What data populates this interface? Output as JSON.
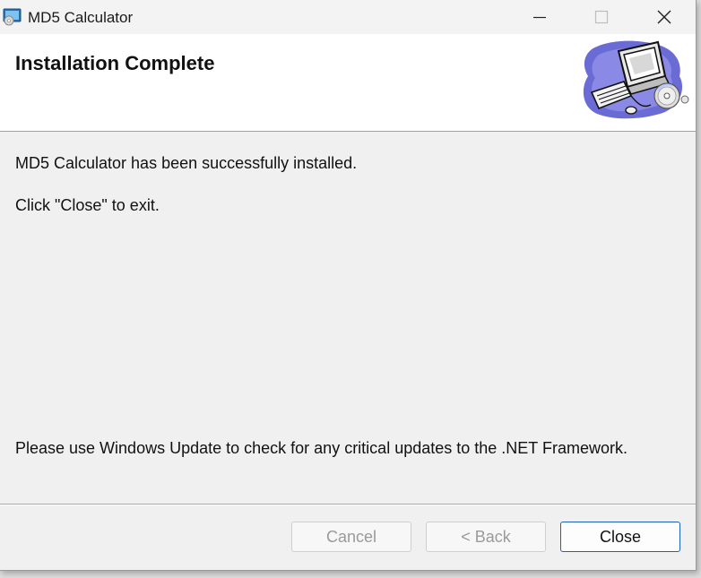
{
  "window": {
    "title": "MD5 Calculator",
    "controls": {
      "minimize": "minimize-icon",
      "maximize": "maximize-icon",
      "close": "close-icon"
    }
  },
  "banner": {
    "title": "Installation Complete",
    "art": "computer-with-cd-icon"
  },
  "body": {
    "line1": "MD5 Calculator has been successfully installed.",
    "line2": "Click \"Close\" to exit.",
    "line3": "Please use Windows Update to check for any critical updates to the .NET Framework."
  },
  "buttons": {
    "cancel": "Cancel",
    "back": "< Back",
    "close": "Close"
  },
  "colors": {
    "accent": "#1c62b9",
    "disabled_text": "#9a9a9a",
    "dialog_bg": "#f0f0f0"
  }
}
